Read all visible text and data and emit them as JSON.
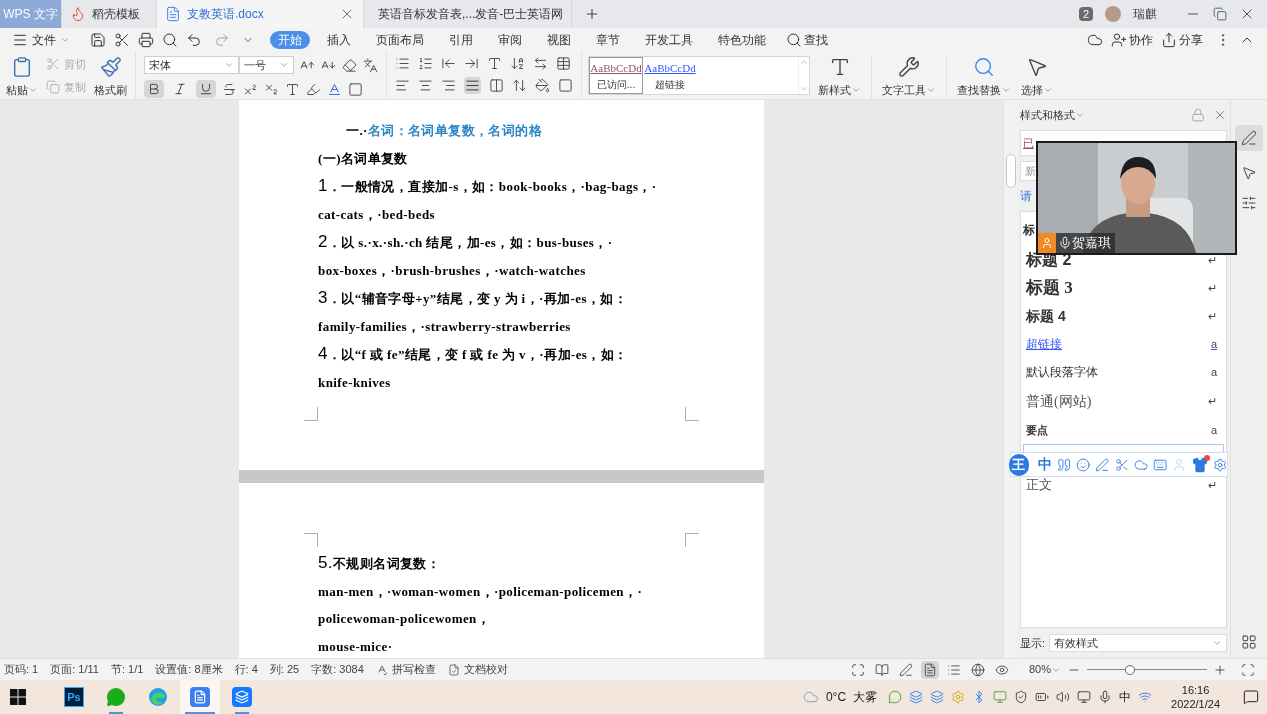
{
  "title_bar": {
    "tabs": [
      {
        "label": "WPS 文字",
        "kind": "home",
        "selected": false
      },
      {
        "label": "稻壳模板",
        "kind": "template",
        "selected": false
      },
      {
        "label": "支教英语.docx",
        "kind": "doc",
        "selected": true
      },
      {
        "label": "英语音标发音表,...发音-巴士英语网",
        "kind": "web",
        "selected": false
      }
    ],
    "badge": "2",
    "user": "瑞麒"
  },
  "menu": {
    "file": "文件",
    "tabs": [
      {
        "label": "开始",
        "selected": true
      },
      {
        "label": "插入",
        "selected": false
      },
      {
        "label": "页面布局",
        "selected": false
      },
      {
        "label": "引用",
        "selected": false
      },
      {
        "label": "审阅",
        "selected": false
      },
      {
        "label": "视图",
        "selected": false
      },
      {
        "label": "章节",
        "selected": false
      },
      {
        "label": "开发工具",
        "selected": false
      },
      {
        "label": "特色功能",
        "selected": false
      }
    ],
    "search": "查找",
    "actions": [
      {
        "kind": "collaborate",
        "label": "协作"
      },
      {
        "kind": "share",
        "label": "分享"
      }
    ]
  },
  "ribbon": {
    "paste": "粘贴",
    "clipboard": [
      {
        "kind": "cut",
        "label": "剪切",
        "disabled": true
      },
      {
        "kind": "copy",
        "label": "复制",
        "disabled": true
      }
    ],
    "painter": "格式刷",
    "font": {
      "family": "宋体",
      "size": "一号"
    },
    "format_buttons": [
      {
        "kind": "bold",
        "selected": true
      },
      {
        "kind": "italic",
        "selected": false
      },
      {
        "kind": "underline",
        "selected": true
      }
    ],
    "styles": [
      {
        "sample": "AaBbCcDd",
        "name": "已访问...",
        "kind": "visited",
        "selected": true
      },
      {
        "sample": "AaBbCcDd",
        "name": "超链接",
        "kind": "link",
        "selected": false
      }
    ],
    "tools": [
      {
        "kind": "new-style",
        "label": "新样式"
      },
      {
        "kind": "text-tools",
        "label": "文字工具"
      },
      {
        "kind": "find",
        "label": "查找替换"
      },
      {
        "kind": "select",
        "label": "选择"
      }
    ]
  },
  "document": {
    "pages": [
      {
        "paragraphs": [
          {
            "kind": "heading",
            "lead": "一.·",
            "lines": [
              "名词：名词单复数，名词的格"
            ]
          },
          {
            "kind": "sub",
            "lines": [
              "(一)名词单复数"
            ]
          },
          {
            "kind": "item",
            "lead": "1",
            "lines": [
              "．一般情况，直接加-s，如：book-books，·bag-bags，·",
              "cat-cats，·bed-beds"
            ]
          },
          {
            "kind": "item",
            "lead": "2",
            "lines": [
              "．以 s.·x.·sh.·ch 结尾，加-es，如：bus-buses，·",
              "box-boxes，·brush-brushes，·watch-watches"
            ]
          },
          {
            "kind": "item",
            "lead": "3",
            "lines": [
              "．以“辅音字母+y”结尾，变 y 为 i，·再加-es，如：",
              "family-families，·strawberry-strawberries"
            ]
          },
          {
            "kind": "item",
            "lead": "4",
            "lines": [
              "．以“f 或 fe”结尾，变 f 或 fe 为 v，·再加-es，如：",
              "knife-knives"
            ]
          }
        ]
      },
      {
        "paragraphs": [
          {
            "kind": "item",
            "lead": "5.",
            "lines": [
              "不规则名词复数："
            ]
          },
          {
            "kind": "plain",
            "lines": [
              "man-men，·woman-women，·policeman-policemen，·"
            ]
          },
          {
            "kind": "plain",
            "lines": [
              "policewoman-policewomen，"
            ]
          },
          {
            "kind": "plain",
            "lines": [
              "mouse-mice·"
            ]
          }
        ]
      }
    ]
  },
  "style_panel": {
    "title": "样式和格式",
    "current": "已",
    "new_field": "新",
    "hint": "请",
    "styles": [
      {
        "kind": "h1",
        "label": "标",
        "selected": false
      },
      {
        "kind": "h2",
        "label": "标题 2",
        "mark": "↵",
        "selected": false
      },
      {
        "kind": "h3",
        "label": "标题 3",
        "mark": "↵",
        "selected": false
      },
      {
        "kind": "h4",
        "label": "标题 4",
        "mark": "↵",
        "selected": false
      },
      {
        "kind": "link",
        "label": "超链接",
        "mark": "a",
        "selected": false
      },
      {
        "kind": "plain",
        "label": "默认段落字体",
        "mark": "a",
        "selected": false
      },
      {
        "kind": "web",
        "label": "普通(网站)",
        "mark": "↵",
        "selected": false
      },
      {
        "kind": "strong",
        "label": "要点",
        "mark": "a",
        "selected": false
      },
      {
        "kind": "blank",
        "selected": true
      },
      {
        "kind": "body",
        "label": "正文",
        "mark": "↵",
        "selected": false
      }
    ],
    "show_label": "显示:",
    "show_value": "有效样式"
  },
  "webcam": {
    "kind": "picture",
    "name": "贺嘉琪"
  },
  "ime": {
    "logo": "王",
    "mode": "中"
  },
  "status_bar": {
    "items": [
      "页码: 1",
      "页面: 1/11",
      "节: 1/1",
      "设置值: 8厘米",
      "行: 4",
      "列: 25",
      "字数: 3084"
    ],
    "buttons": [
      {
        "kind": "spell",
        "label": "拼写检查"
      },
      {
        "kind": "proof",
        "label": "文档校对"
      }
    ],
    "views": [
      {
        "kind": "fullscreen",
        "selected": false
      },
      {
        "kind": "read",
        "selected": false
      },
      {
        "kind": "write",
        "selected": false
      },
      {
        "kind": "page",
        "selected": true
      },
      {
        "kind": "outline",
        "selected": false
      },
      {
        "kind": "web",
        "selected": false
      },
      {
        "kind": "eye",
        "selected": false
      }
    ],
    "zoom": "80%",
    "zoom_level": {
      "level": 0.36
    }
  },
  "taskbar": {
    "apps": [
      {
        "kind": "ps",
        "label": "Ps",
        "running": false,
        "active": false
      },
      {
        "kind": "wechat",
        "running": true,
        "active": false
      },
      {
        "kind": "edge",
        "running": false,
        "active": false
      },
      {
        "kind": "wps",
        "running": true,
        "active": true
      },
      {
        "kind": "meeting",
        "running": true,
        "active": false
      }
    ],
    "temperature": "0°C",
    "weather": "大雾",
    "ime": "中",
    "time": "16:16",
    "date": "2022/1/24"
  }
}
